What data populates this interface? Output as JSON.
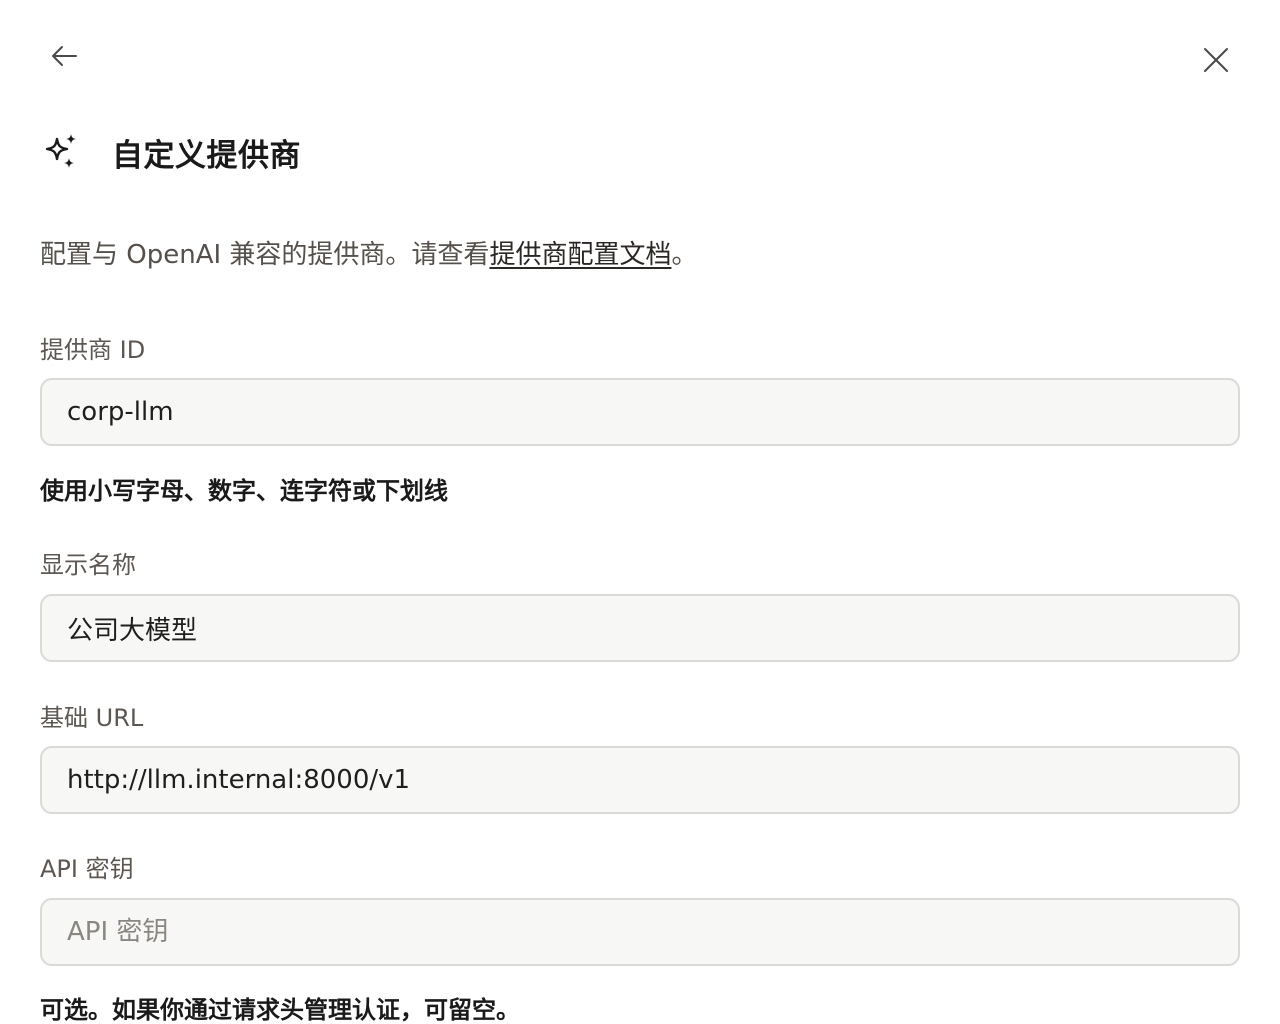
{
  "dialog": {
    "back_icon": "arrow-left-icon",
    "close_icon": "close-icon",
    "header_icon": "sparkles-icon",
    "title": "自定义提供商"
  },
  "description": {
    "prefix": "配置与 OpenAI 兼容的提供商。请查看",
    "link_text": "提供商配置文档",
    "suffix": "。"
  },
  "fields": {
    "provider_id": {
      "label": "提供商 ID",
      "value": "corp-llm",
      "hint": "使用小写字母、数字、连字符或下划线"
    },
    "display_name": {
      "label": "显示名称",
      "value": "公司大模型"
    },
    "base_url": {
      "label": "基础 URL",
      "value": "http://llm.internal:8000/v1"
    },
    "api_key": {
      "label": "API 密钥",
      "value": "",
      "placeholder": "API 密钥",
      "hint": "可选。如果你通过请求头管理认证，可留空。"
    }
  }
}
